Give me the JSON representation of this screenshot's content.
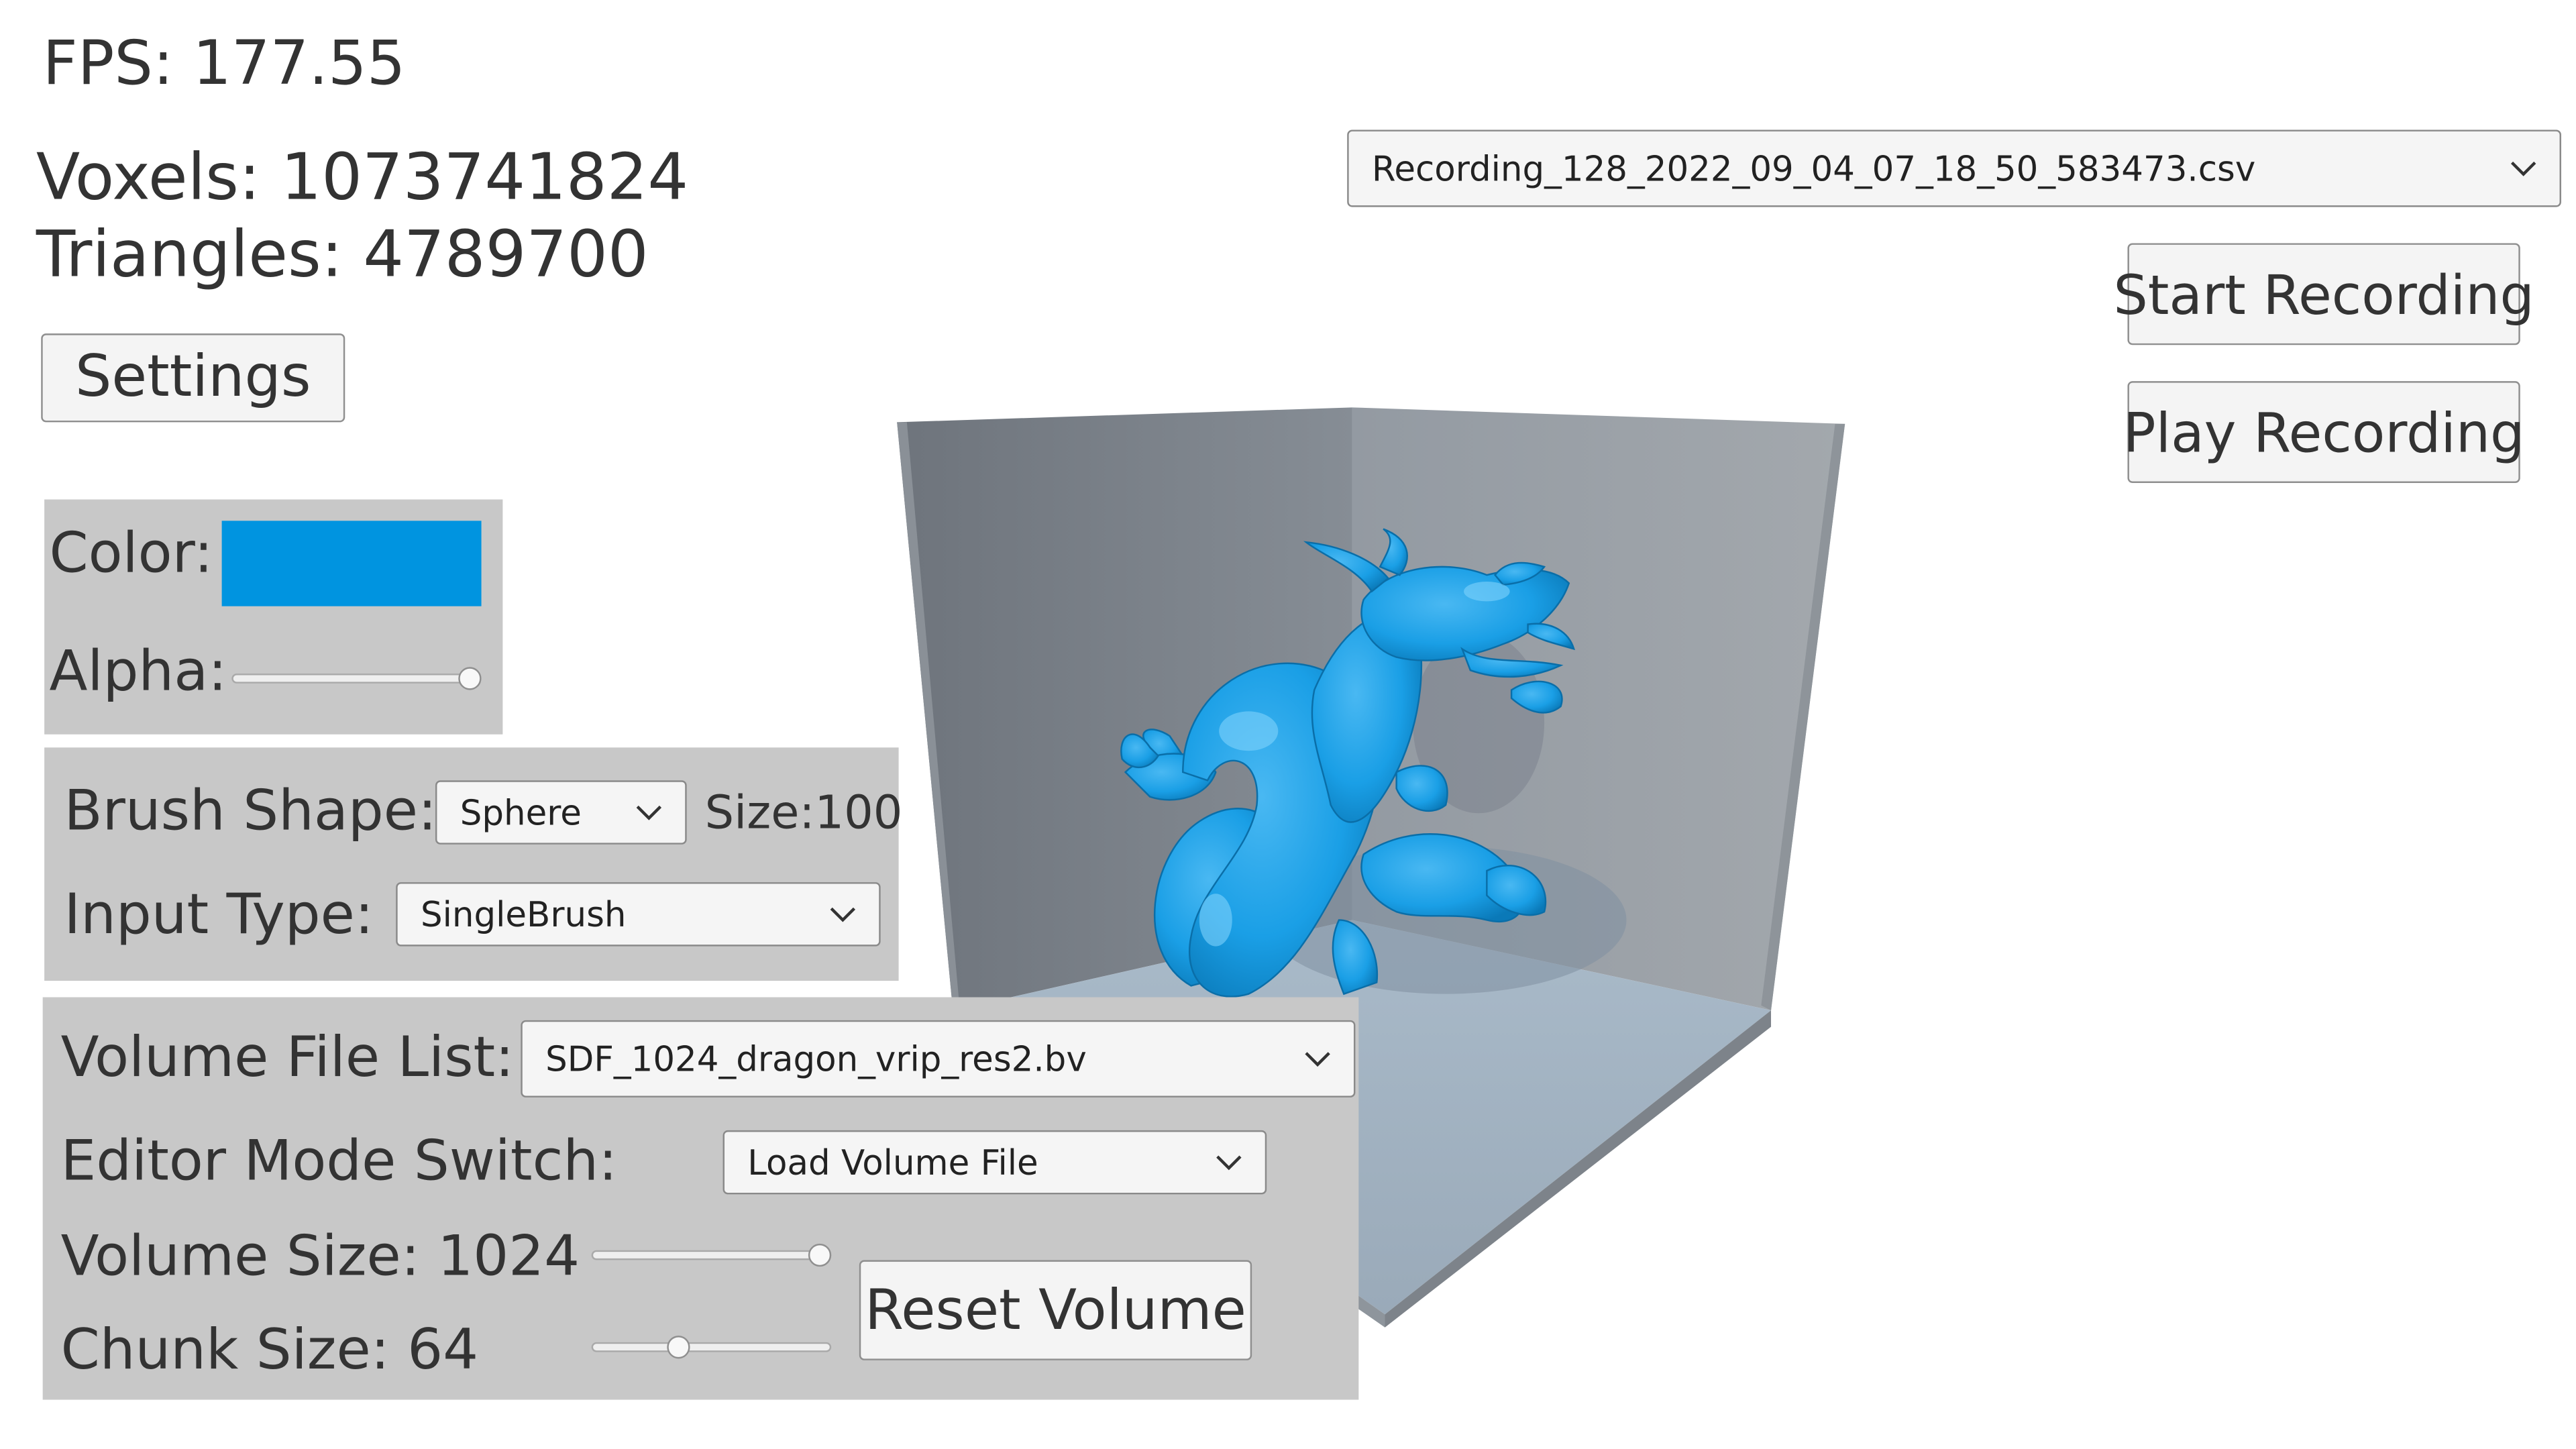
{
  "stats": {
    "fps": "FPS: 177.55",
    "voxels": "Voxels: 1073741824",
    "triangles": "Triangles: 4789700"
  },
  "buttons": {
    "settings": "Settings",
    "start_recording": "Start Recording",
    "play_recording": "Play Recording",
    "reset_volume": "Reset Volume"
  },
  "recording": {
    "selected_file": "Recording_128_2022_09_04_07_18_50_583473.csv"
  },
  "color_panel": {
    "color_label": "Color:",
    "color_value": "#0094e0",
    "alpha_label": "Alpha:",
    "alpha_level": 1.0
  },
  "brush_panel": {
    "brush_shape_label": "Brush Shape:",
    "brush_shape_value": "Sphere",
    "size_label": "Size:100",
    "input_type_label": "Input Type:",
    "input_type_value": "SingleBrush"
  },
  "volume_panel": {
    "volume_file_label": "Volume File List:",
    "volume_file_value": "SDF_1024_dragon_vrip_res2.bv",
    "editor_mode_label": "Editor Mode Switch:",
    "editor_mode_value": "Load Volume File",
    "volume_size_label": "Volume Size: 1024",
    "volume_size_level": 1.0,
    "chunk_size_label": "Chunk Size: 64",
    "chunk_size_level": 0.35
  },
  "viewport": {
    "model_color": "#1a9fe6",
    "icons": [
      "chevron-down-icon"
    ]
  }
}
